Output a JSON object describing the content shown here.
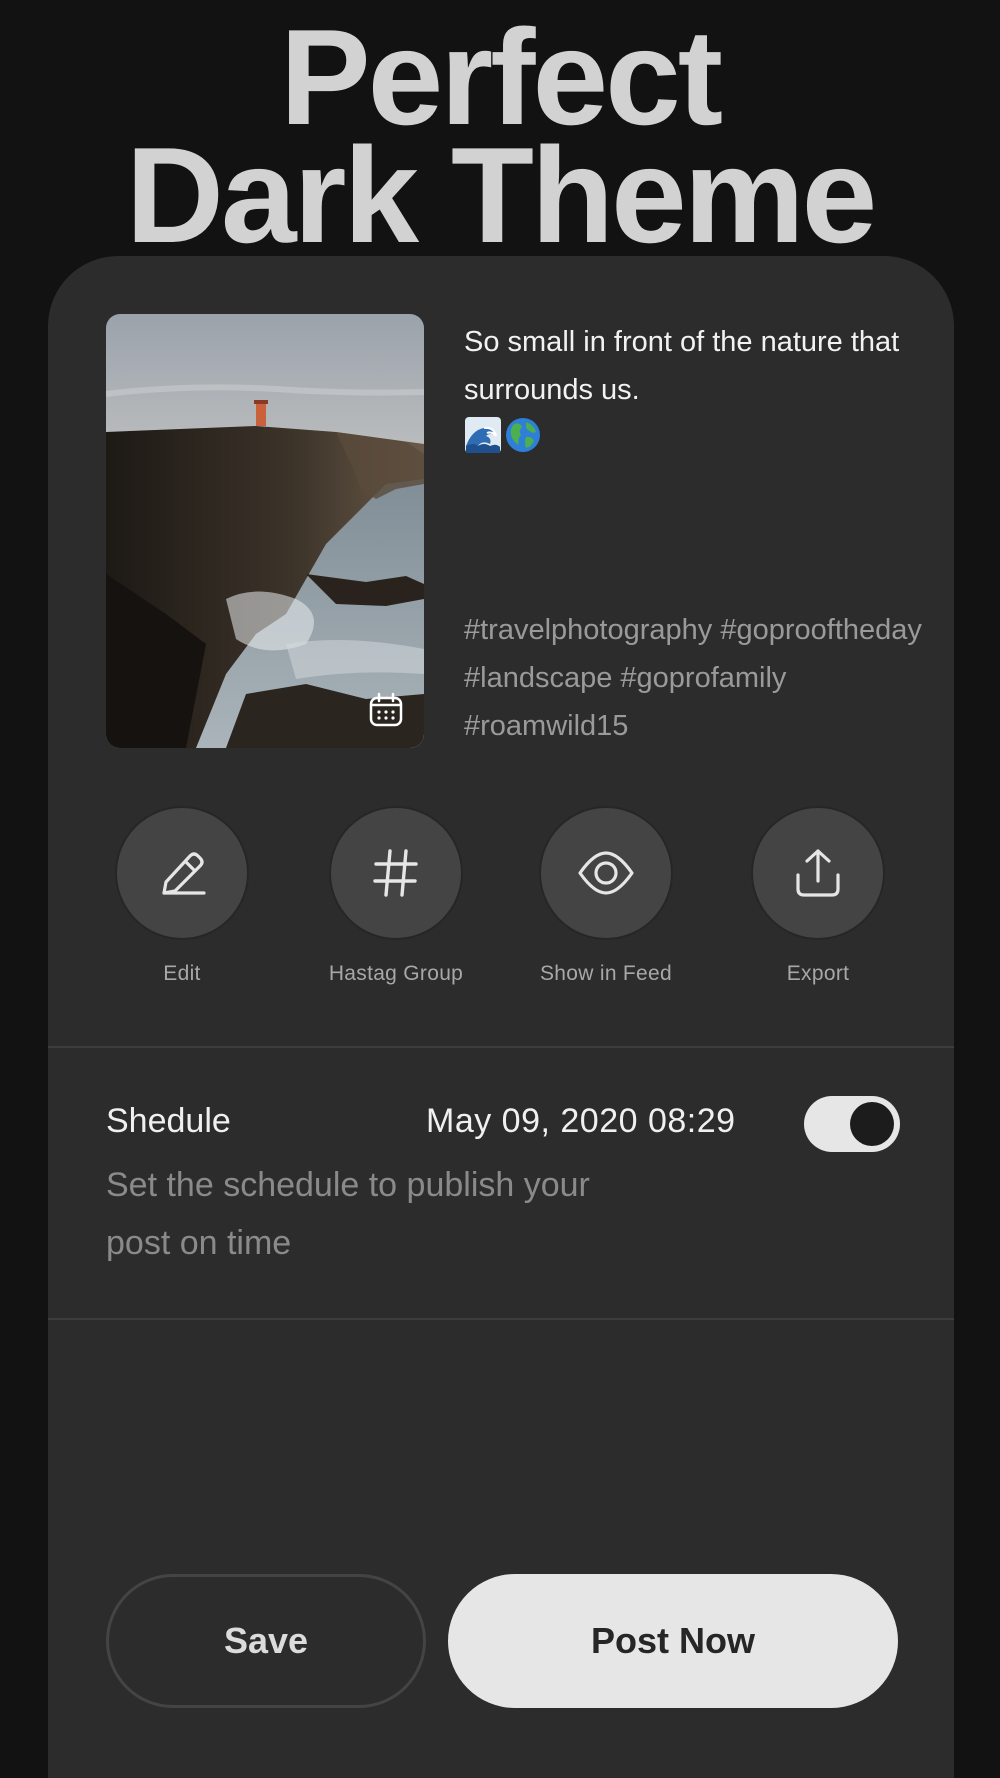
{
  "hero": {
    "line1": "Perfect",
    "line2": "Dark Theme"
  },
  "post": {
    "caption": "So small in front of the nature that surrounds us.",
    "emojis": [
      "wave-emoji",
      "globe-emoji"
    ],
    "hashtags": " #travelphotography #goprooftheday #landscape #goprofamily #roamwild15",
    "photo_icon": "calendar-icon"
  },
  "actions": [
    {
      "label": "Edit",
      "icon": "pencil-icon"
    },
    {
      "label": "Hastag Group",
      "icon": "hashtag-icon"
    },
    {
      "label": "Show in Feed",
      "icon": "eye-icon"
    },
    {
      "label": "Export",
      "icon": "share-upload-icon"
    }
  ],
  "schedule": {
    "title": "Shedule",
    "datetime": "May 09, 2020 08:29",
    "description": "Set the schedule to publish your post on time",
    "enabled": true
  },
  "buttons": {
    "save": "Save",
    "post_now": "Post Now"
  },
  "colors": {
    "background": "#121212",
    "card": "#2c2c2c",
    "accent_light": "#e6e6e6"
  }
}
